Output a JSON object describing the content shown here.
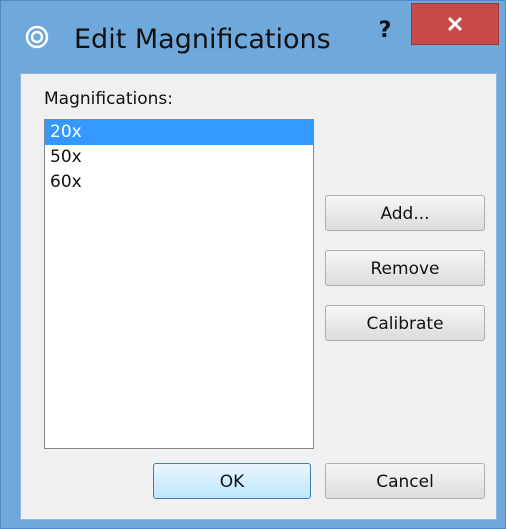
{
  "window": {
    "title": "Edit Magnifications",
    "app_icon": "concentric-circles-icon",
    "help_label": "?",
    "close_icon": "close-icon",
    "colors": {
      "frame": "#6fa9dc",
      "close_button": "#c74a49",
      "selection": "#3399ff"
    }
  },
  "list": {
    "label": "Magnifications:",
    "items": [
      "20x",
      "50x",
      "60x"
    ],
    "selected": "20x"
  },
  "buttons": {
    "add": "Add...",
    "remove": "Remove",
    "calibrate": "Calibrate",
    "ok": "OK",
    "cancel": "Cancel"
  }
}
